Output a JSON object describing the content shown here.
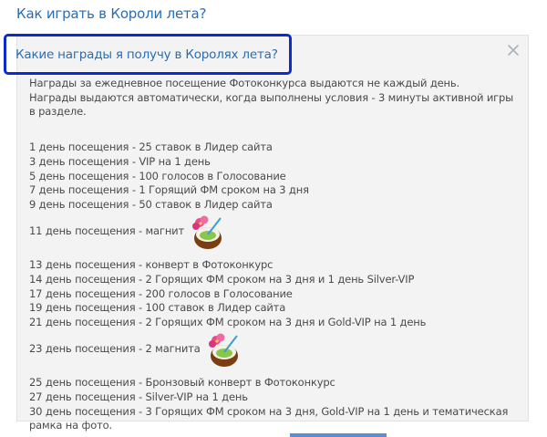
{
  "top_link": "Как играть в Короли лета?",
  "panel": {
    "title": "Какие награды я получу в Королях лета?",
    "intro": [
      "Награды за ежедневное посещение Фотоконкурса выдаются не каждый день.",
      "Награды выдаются автоматически, когда выполнены условия - 3 минуты активной игры",
      "в разделе."
    ],
    "rewards_a": [
      "1 день посещения -  25 ставок в Лидер сайта",
      "3 день посещения - VIP на 1 день",
      "5 день посещения - 100 голосов в Голосование",
      "7 день посещения - 1 Горящий ФМ сроком на 3 дня",
      "9 день посещения - 50 ставок  в Лидер сайта"
    ],
    "reward_11": "11 день посещения - магнит",
    "rewards_b": [
      "13 день посещения -  конверт в Фотоконкурс",
      "14 день посещения - 2 Горящих ФМ сроком на 3 дня и 1 день Silver-VIP",
      "17 день посещения - 200  голосов в Голосование",
      "19 день посещения - 100 ставок в Лидер сайта",
      "21 день посещения - 2 Горящих ФМ сроком на 3 дня и Gold-VIP на 1 день"
    ],
    "reward_23": "23 день посещения - 2 магнита",
    "rewards_c": [
      "25 день посещения - Бронзовый конверт в Фотоконкурс",
      "27 день посещения - Silver-VIP на 1 день",
      "30 день посещения - 3 Горящих ФМ сроком на 3 дня, Gold-VIP на 1 день и тематическая",
      "рамка на фото."
    ]
  },
  "icons": {
    "close": "close-icon",
    "magnet": "coconut-magnet-icon"
  },
  "colors": {
    "link": "#2a6db3",
    "highlight": "#0b2ad0",
    "panel_bg": "#f3f3f3",
    "text": "#4a4a4a"
  }
}
